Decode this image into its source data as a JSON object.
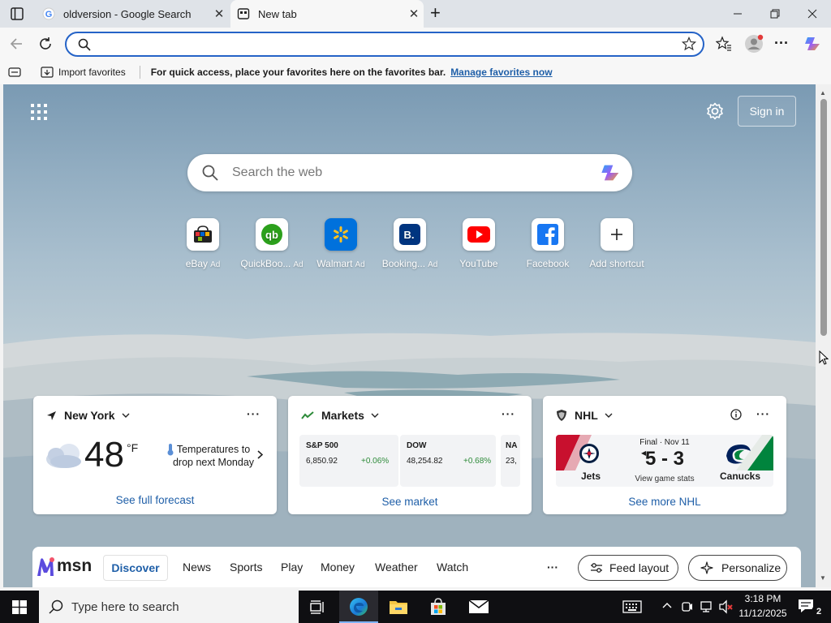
{
  "browser": {
    "tabs": [
      {
        "title": "oldversion - Google Search"
      },
      {
        "title": "New tab"
      }
    ],
    "address_bar": {
      "value": ""
    }
  },
  "favorites_bar": {
    "import_label": "Import favorites",
    "message": "For quick access, place your favorites here on the favorites bar.",
    "manage_link": "Manage favorites now"
  },
  "newtab": {
    "sign_in": "Sign in",
    "search": {
      "placeholder": "Search the web"
    },
    "shortcuts": [
      {
        "label": "eBay",
        "ad": "Ad"
      },
      {
        "label": "QuickBoo...",
        "ad": "Ad"
      },
      {
        "label": "Walmart",
        "ad": "Ad"
      },
      {
        "label": "Booking...",
        "ad": "Ad"
      },
      {
        "label": "YouTube",
        "ad": ""
      },
      {
        "label": "Facebook",
        "ad": ""
      },
      {
        "label": "Add shortcut",
        "ad": ""
      }
    ],
    "weather": {
      "location": "New York",
      "temperature": "48",
      "unit": "°F",
      "alert": "Temperatures to drop next Monday",
      "link": "See full forecast"
    },
    "markets": {
      "title": "Markets",
      "items": [
        {
          "name": "S&P 500",
          "value": "6,850.92",
          "change": "+0.06%"
        },
        {
          "name": "DOW",
          "value": "48,254.82",
          "change": "+0.68%"
        },
        {
          "name": "NA",
          "value": "23,"
        }
      ],
      "link": "See market"
    },
    "nhl": {
      "title": "NHL",
      "status": "Final · Nov 11",
      "score": "5 - 3",
      "stats_link": "View game stats",
      "home_team": "Jets",
      "away_team": "Canucks",
      "link": "See more NHL"
    },
    "msn": {
      "logo": "msn",
      "tabs": [
        "Discover",
        "News",
        "Sports",
        "Play",
        "Money",
        "Weather",
        "Watch"
      ],
      "more": "···",
      "feed_layout": "Feed layout",
      "personalize": "Personalize"
    }
  },
  "taskbar": {
    "search_placeholder": "Type here to search",
    "time": "3:18 PM",
    "date": "11/12/2025",
    "notifications": "2"
  },
  "colors": {
    "accent": "#1f5fa8",
    "omnibox_border": "#2563c7",
    "positive": "#2e8b3a",
    "taskbar": "#0f0f12"
  }
}
